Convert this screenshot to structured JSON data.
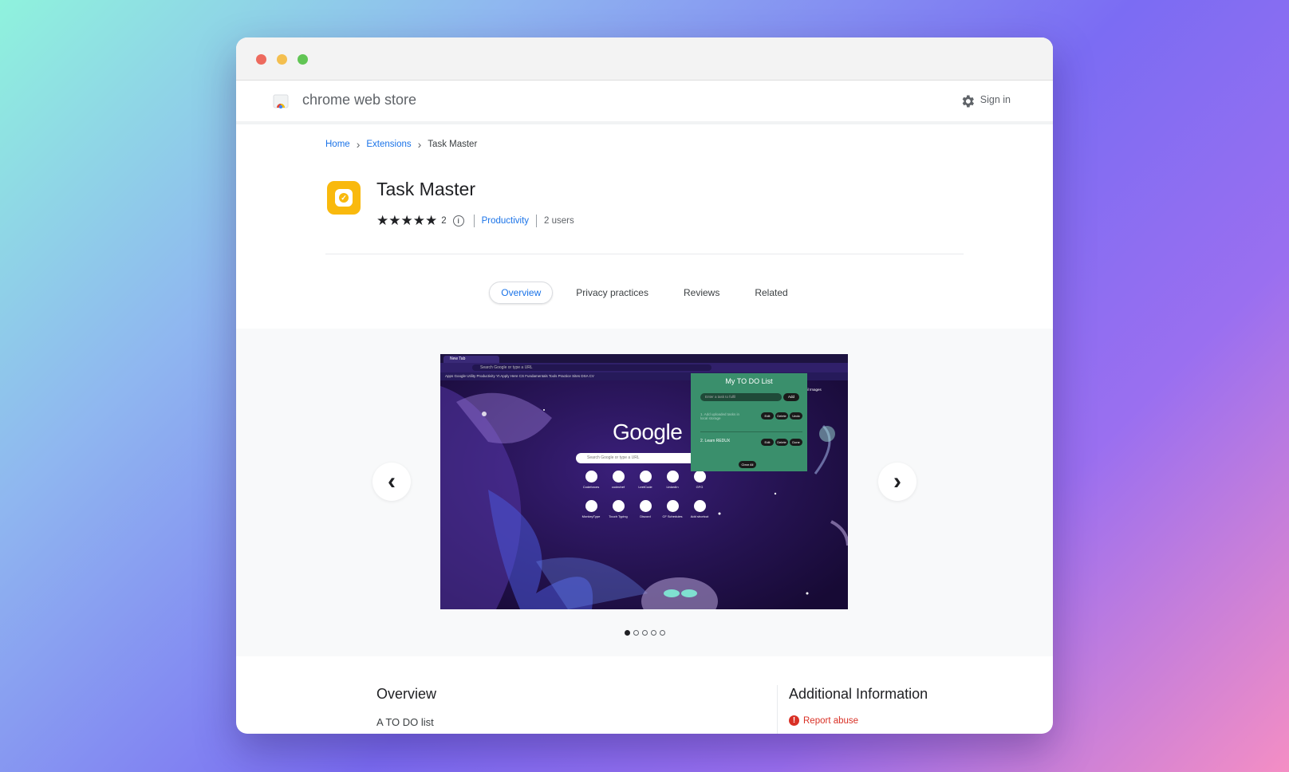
{
  "store": {
    "title": "chrome web store",
    "sign_in": "Sign in"
  },
  "breadcrumb": {
    "home": "Home",
    "extensions": "Extensions",
    "current": "Task Master",
    "sep": "›"
  },
  "extension": {
    "name": "Task Master",
    "stars": "★★★★★",
    "rating_value": 5,
    "rating_count": "2",
    "info": "i",
    "category": "Productivity",
    "users": "2 users"
  },
  "tabs": [
    "Overview",
    "Privacy practices",
    "Reviews",
    "Related"
  ],
  "gallery": {
    "prev": "‹",
    "next": "›",
    "current_slide": 1,
    "slide_count": 5,
    "screenshot": {
      "tab_label": "New Tab",
      "address_placeholder": "Search Google or type a URL",
      "bookmarks": "Apps   Google   Utility   Productivity   Yt   Apply Here   CS Fundamentals   Tools   Practice Sites   DSA   CV",
      "gmail_images": "Gmail   Images",
      "google_logo": "Google",
      "search_placeholder": "Search Google or type a URL",
      "shortcuts": [
        "Codeforces",
        "codechef",
        "LeetCode",
        "LinkedIn",
        "GFG",
        "MonkeyType",
        "Touch Typing",
        "Discord",
        "CF Schedules",
        "Add shortcut"
      ],
      "popup": {
        "title": "My TO DO List",
        "input_placeholder": "Enter a task to fulfil",
        "add": "Add",
        "item1": "1. Add uploaded tasks in local storage",
        "item1_buttons": [
          "Edit",
          "Delete",
          "Undo"
        ],
        "item2": "2. Learn REDUX",
        "item2_buttons": [
          "Edit",
          "Delete",
          "Done"
        ],
        "clear": "Clear All"
      }
    }
  },
  "overview": {
    "heading": "Overview",
    "text": "A TO DO list"
  },
  "additional": {
    "heading": "Additional Information",
    "report": "Report abuse",
    "report_icon": "!"
  },
  "colors": {
    "link": "#1a73e8",
    "popup": "#3a8f6c",
    "icon": "#f9b90d",
    "danger": "#d93025"
  }
}
